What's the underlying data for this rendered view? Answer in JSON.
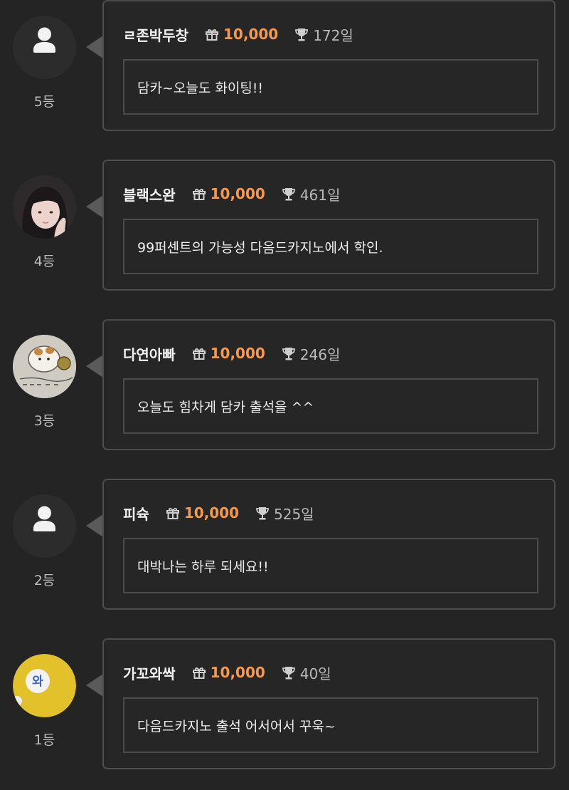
{
  "entries": [
    {
      "rank": "5등",
      "nickname": "ㄹ존박두창",
      "points": "10,000",
      "days": "172일",
      "message": "담카~오늘도 화이팅!!",
      "avatar": "default-user-icon"
    },
    {
      "rank": "4등",
      "nickname": "블랙스완",
      "points": "10,000",
      "days": "461일",
      "message": "99퍼센트의 가능성 다음드카지노에서 학인.",
      "avatar": "profile-photo"
    },
    {
      "rank": "3등",
      "nickname": "다연아빠",
      "points": "10,000",
      "days": "246일",
      "message": "오늘도 힘차게 담카 출석을 ^^",
      "avatar": "profile-drawing"
    },
    {
      "rank": "2등",
      "nickname": "피슉",
      "points": "10,000",
      "days": "525일",
      "message": "대박나는 하루 되세요!!",
      "avatar": "default-user-icon"
    },
    {
      "rank": "1등",
      "nickname": "가꼬와싹",
      "points": "10,000",
      "days": "40일",
      "message": "다음드카지노 출석 어서어서 꾸욱~",
      "avatar": "profile-badge",
      "avatar_badge_text": "와"
    }
  ],
  "colors": {
    "background": "#242424",
    "card_border": "#4c4c4c",
    "points_accent": "#f39a4f",
    "badge_yellow": "#e3c12a"
  },
  "icons": {
    "gift": "gift-icon",
    "trophy": "trophy-icon",
    "user": "user-icon"
  }
}
